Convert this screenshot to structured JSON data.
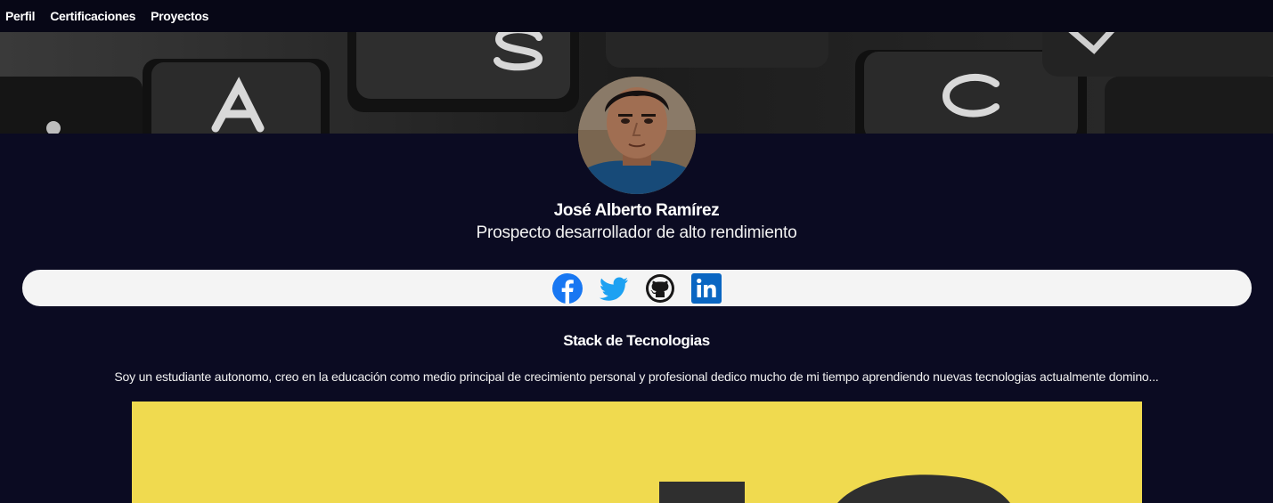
{
  "nav": {
    "items": [
      {
        "label": "Perfil"
      },
      {
        "label": "Certificaciones"
      },
      {
        "label": "Proyectos"
      }
    ]
  },
  "profile": {
    "name": "José Alberto Ramírez",
    "role": "Prospecto desarrollador de alto rendimiento"
  },
  "social": {
    "links": [
      {
        "icon": "facebook-icon",
        "color": "#1877f2"
      },
      {
        "icon": "twitter-icon",
        "color": "#1da1f2"
      },
      {
        "icon": "github-icon",
        "color": "#181717"
      },
      {
        "icon": "linkedin-icon",
        "color": "#0a66c2"
      }
    ]
  },
  "stack": {
    "title": "Stack de Tecnologias",
    "bio": "Soy un estudiante autonomo, creo en la educación como medio principal de crecimiento personal y profesional dedico mucho de mi tiempo aprendiendo nuevas tecnologias actualmente domino..."
  },
  "colors": {
    "background": "#0b0b22",
    "nav_background": "#070716",
    "social_bar": "#f4f4f4",
    "js_yellow": "#f0da4f"
  }
}
